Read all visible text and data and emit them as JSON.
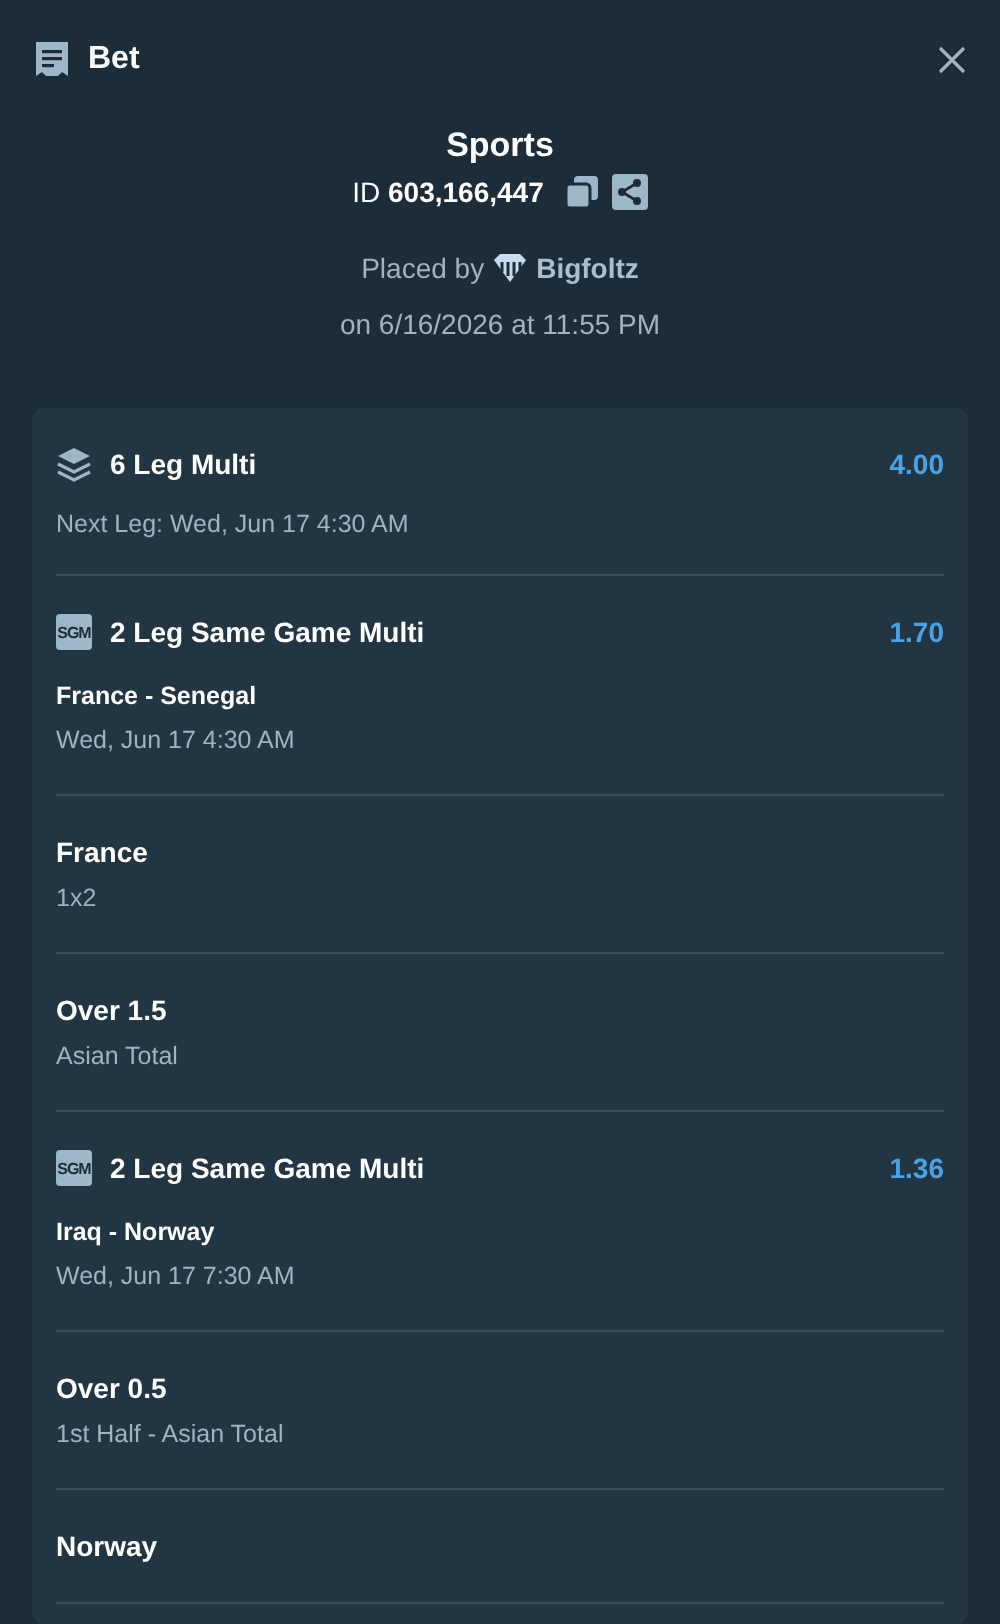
{
  "header": {
    "title": "Bet"
  },
  "summary": {
    "category": "Sports",
    "id_label": "ID",
    "id_value": "603,166,447",
    "placed_by_label": "Placed by",
    "user": "Bigfoltz",
    "placed_on": "on 6/16/2026 at 11:55 PM"
  },
  "legs": [
    {
      "kind": "multi",
      "title": "6 Leg Multi",
      "odds": "4.00",
      "detail": "Next Leg: Wed, Jun 17 4:30 AM"
    },
    {
      "kind": "sgm",
      "badge": "SGM",
      "title": "2 Leg Same Game Multi",
      "odds": "1.70",
      "match": "France - Senegal",
      "time": "Wed, Jun 17 4:30 AM"
    },
    {
      "kind": "selection",
      "name": "France",
      "market": "1x2"
    },
    {
      "kind": "selection",
      "name": "Over 1.5",
      "market": "Asian Total"
    },
    {
      "kind": "sgm",
      "badge": "SGM",
      "title": "2 Leg Same Game Multi",
      "odds": "1.36",
      "match": "Iraq - Norway",
      "time": "Wed, Jun 17 7:30 AM"
    },
    {
      "kind": "selection",
      "name": "Over 0.5",
      "market": "1st Half - Asian Total"
    },
    {
      "kind": "selection",
      "name": "Norway"
    }
  ]
}
